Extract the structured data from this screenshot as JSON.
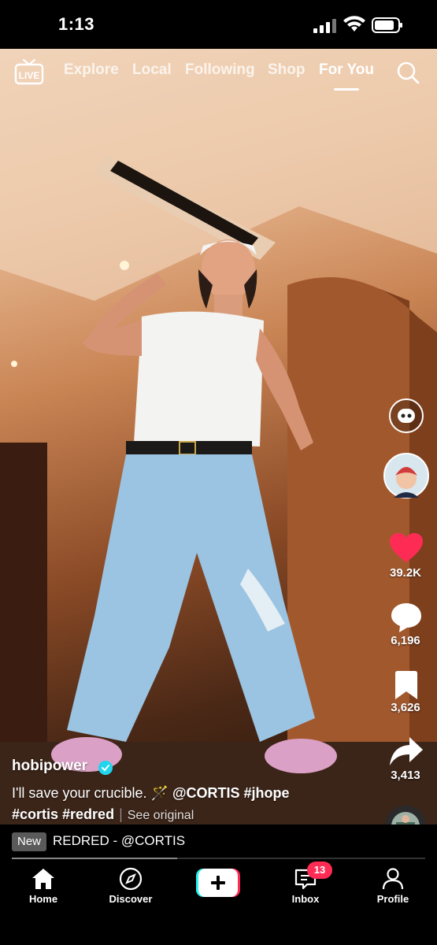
{
  "status_bar": {
    "time": "1:13"
  },
  "top_nav": {
    "tabs": [
      {
        "label": "Explore"
      },
      {
        "label": "Local"
      },
      {
        "label": "Following"
      },
      {
        "label": "Shop"
      },
      {
        "label": "For You"
      }
    ],
    "active_tab": "For You",
    "live_label": "LIVE"
  },
  "rail": {
    "likes": "39.2K",
    "comments": "6,196",
    "saves": "3,626",
    "shares": "3,413",
    "like_color": "#fe2c55"
  },
  "post": {
    "username": "hobipower",
    "caption_text": "I'll save your crucible.",
    "caption_emoji": "🪄",
    "mention": "@CORTIS",
    "hashtags_line1": "#jhope",
    "hashtags_line2": "#cortis #redred",
    "see_original": "See original"
  },
  "music": {
    "badge": "New",
    "title": "REDRED - @CORTIS",
    "progress": 0.4
  },
  "bottom_nav": {
    "home": "Home",
    "discover": "Discover",
    "inbox": "Inbox",
    "inbox_count": "13",
    "profile": "Profile"
  }
}
